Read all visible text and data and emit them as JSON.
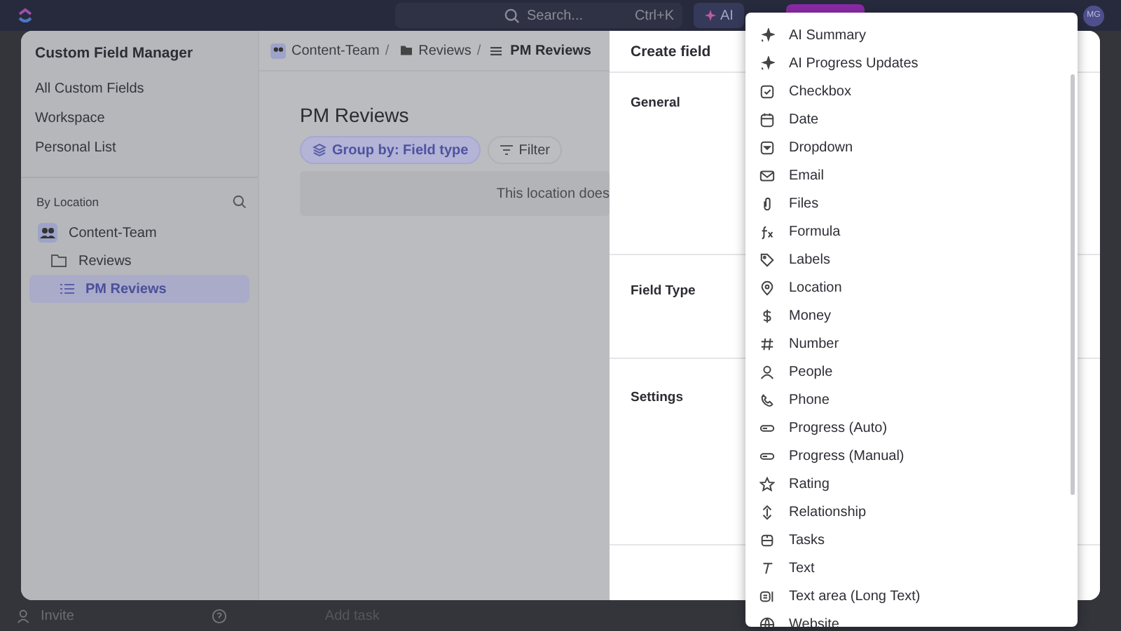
{
  "top_bar": {
    "search": {
      "placeholder": "Search...",
      "shortcut": "Ctrl+K"
    },
    "ai_button": "AI",
    "avatar": "MG"
  },
  "sidebar": {
    "title": "Custom Field Manager",
    "items": [
      {
        "label": "All Custom Fields",
        "selected": false
      },
      {
        "label": "Workspace",
        "selected": false
      },
      {
        "label": "Personal List",
        "selected": false
      }
    ],
    "section_title": "By Location",
    "tree": [
      {
        "label": "Content-Team",
        "selected": false,
        "children": [
          {
            "label": "Reviews",
            "selected": false,
            "children": [
              {
                "label": "PM Reviews",
                "selected": true
              }
            ]
          }
        ]
      }
    ]
  },
  "breadcrumb": {
    "items": [
      "Content-Team",
      "Reviews",
      "PM Reviews"
    ],
    "separator": "/"
  },
  "main": {
    "title": "PM Reviews",
    "group_by": "Group by: Field type",
    "filter": "Filter",
    "empty_message": "This location does"
  },
  "create_field": {
    "title": "Create field",
    "sections": [
      "General",
      "Field Type",
      "Settings"
    ]
  },
  "field_type_menu": {
    "items": [
      "AI Summary",
      "AI Progress Updates",
      "Checkbox",
      "Date",
      "Dropdown",
      "Email",
      "Files",
      "Formula",
      "Labels",
      "Location",
      "Money",
      "Number",
      "People",
      "Phone",
      "Progress (Auto)",
      "Progress (Manual)",
      "Rating",
      "Relationship",
      "Tasks",
      "Text",
      "Text area (Long Text)",
      "Website"
    ]
  },
  "bottom_bar": {
    "invite": "Invite",
    "add_task": "Add task"
  }
}
